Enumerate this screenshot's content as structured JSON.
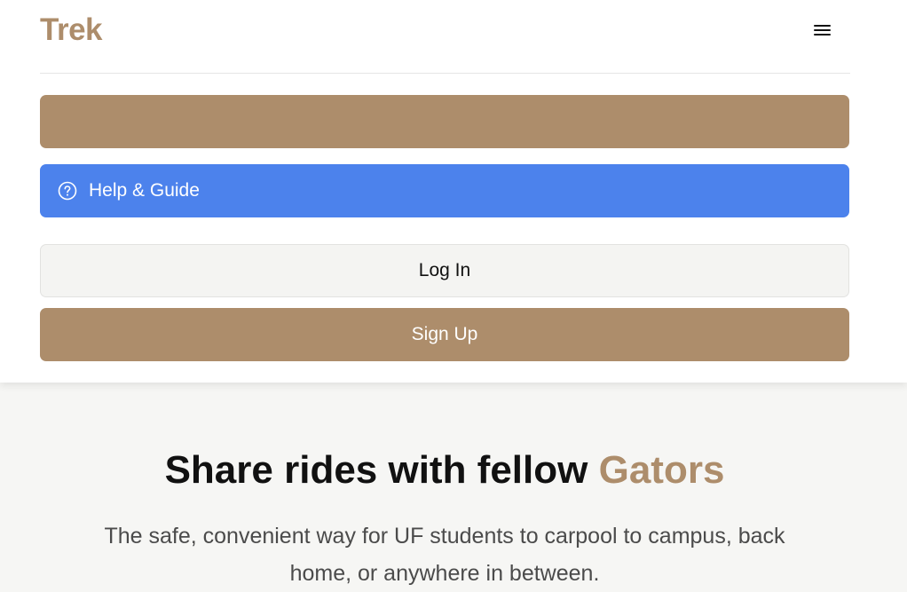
{
  "brand": {
    "logo_text": "Trek",
    "accent_color": "#ad8d6b"
  },
  "header": {
    "menu_icon": "hamburger-menu-icon"
  },
  "menu": {
    "help": {
      "label": "Help & Guide",
      "icon": "question-circle-icon",
      "color": "#4c82ec"
    },
    "login_label": "Log In",
    "signup_label": "Sign Up"
  },
  "hero": {
    "title_prefix": "Share rides with fellow",
    "title_accent": "Gators",
    "subtitle": "The safe, convenient way for UF students to carpool to campus, back home, or anywhere in between."
  }
}
